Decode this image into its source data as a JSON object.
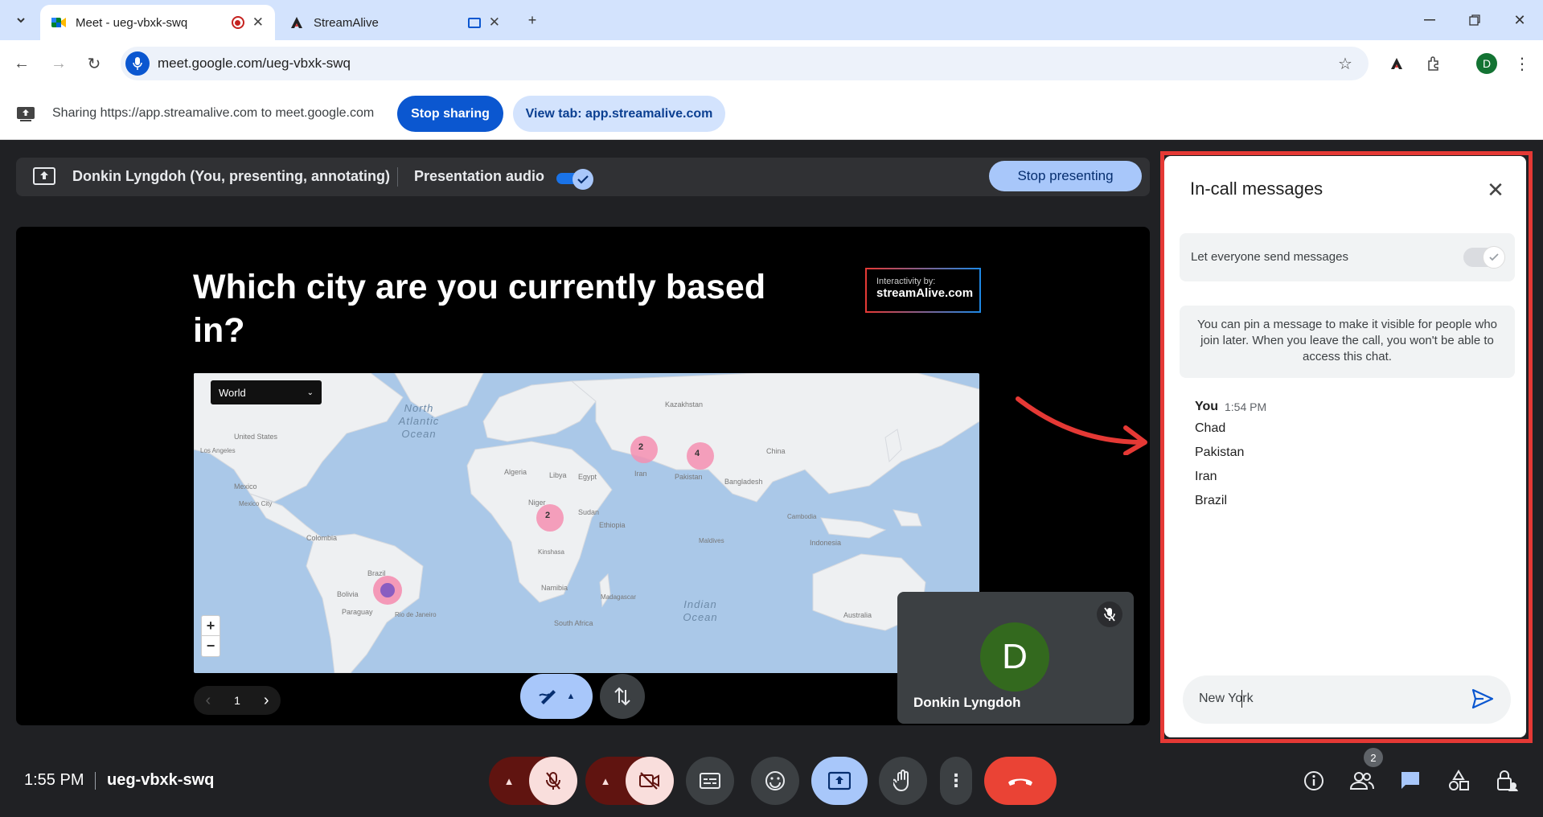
{
  "browser": {
    "tabs": [
      {
        "title": "Meet - ueg-vbxk-swq",
        "active": true
      },
      {
        "title": "StreamAlive",
        "active": false
      }
    ],
    "url": "meet.google.com/ueg-vbxk-swq",
    "profile_initial": "D"
  },
  "share_bar": {
    "text": "Sharing https://app.streamalive.com to meet.google.com",
    "stop_label": "Stop sharing",
    "view_label": "View tab: app.streamalive.com"
  },
  "presenting": {
    "name": "Donkin Lyngdoh (You, presenting, annotating)",
    "audio_label": "Presentation audio",
    "stop_label": "Stop presenting"
  },
  "slide": {
    "question": "Which city are you currently based in?",
    "badge_top": "Interactivity by:",
    "badge_brand": "streamAlive.com",
    "map_dropdown": "World",
    "page_number": "1",
    "map_labels": {
      "north_atlantic": "North Atlantic Ocean",
      "indian": "Indian Ocean",
      "kazakhstan": "Kazakhstan",
      "united_states": "United States",
      "mexico": "Mexico",
      "brazil": "Brazil",
      "bolivia": "Bolivia",
      "paraguay": "Paraguay",
      "algeria": "Algeria",
      "libya": "Libya",
      "egypt": "Egypt",
      "niger": "Niger",
      "sudan": "Sudan",
      "ethiopia": "Ethiopia",
      "kinshasa": "Kinshasa",
      "namibia": "Namibia",
      "south_africa": "South Africa",
      "china": "China",
      "pakistan": "Pakistan",
      "bangladesh": "Bangladesh",
      "maldives": "Maldives",
      "australia": "Australia",
      "colombia": "Colombia",
      "los_angeles": "Los Angeles",
      "mexico_city": "Mexico City",
      "rio": "Rio de Janeiro",
      "madagascar": "Madagascar",
      "iran": "Iran",
      "cambodia": "Cambodia",
      "indonesia": "Indonesia"
    },
    "clusters": [
      {
        "label": "2"
      },
      {
        "label": "4"
      },
      {
        "label": "2"
      },
      {
        "label": ""
      }
    ]
  },
  "self_tile": {
    "initial": "D",
    "name": "Donkin Lyngdoh"
  },
  "chat": {
    "title": "In-call messages",
    "toggle_label": "Let everyone send messages",
    "info": "You can pin a message to make it visible for people who join later. When you leave the call, you won't be able to access this chat.",
    "sender": "You",
    "time": "1:54 PM",
    "messages": [
      "Chad",
      "Pakistan",
      "Iran",
      "Brazil"
    ],
    "input_value": "New York"
  },
  "bottom": {
    "time": "1:55 PM",
    "meeting_code": "ueg-vbxk-swq",
    "people_count": "2"
  },
  "colors": {
    "accent_blue": "#0b57d0",
    "light_blue": "#a8c7fa",
    "hangup_red": "#ea4335",
    "annotation_red": "#e53935"
  }
}
